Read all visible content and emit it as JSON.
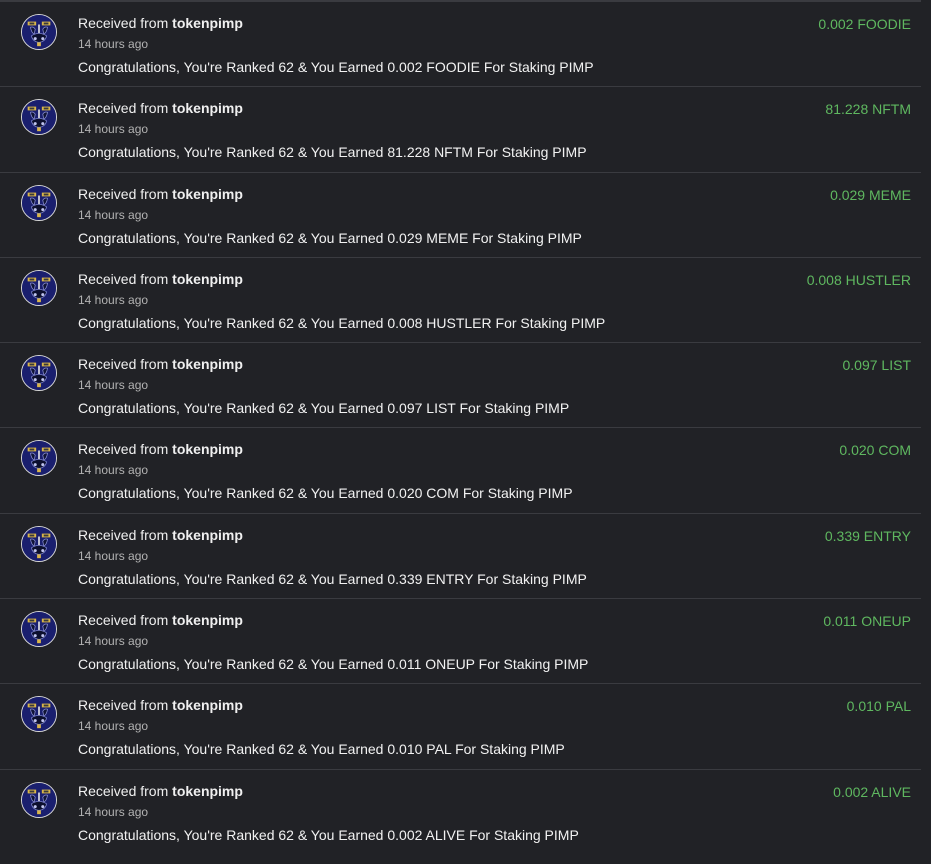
{
  "colors": {
    "background": "#212226",
    "divider": "#3a3b40",
    "amount": "#5fb860",
    "avatar_bg": "#1a1f6e"
  },
  "avatar_icon": "pimp-avatar-icon",
  "transactions": [
    {
      "prefix": "Received from",
      "sender": "tokenpimp",
      "time": "14 hours ago",
      "message": "Congratulations, You're Ranked 62 & You Earned 0.002 FOODIE For Staking PIMP",
      "amount": "0.002 FOODIE"
    },
    {
      "prefix": "Received from",
      "sender": "tokenpimp",
      "time": "14 hours ago",
      "message": "Congratulations, You're Ranked 62 & You Earned 81.228 NFTM For Staking PIMP",
      "amount": "81.228 NFTM"
    },
    {
      "prefix": "Received from",
      "sender": "tokenpimp",
      "time": "14 hours ago",
      "message": "Congratulations, You're Ranked 62 & You Earned 0.029 MEME For Staking PIMP",
      "amount": "0.029 MEME"
    },
    {
      "prefix": "Received from",
      "sender": "tokenpimp",
      "time": "14 hours ago",
      "message": "Congratulations, You're Ranked 62 & You Earned 0.008 HUSTLER For Staking PIMP",
      "amount": "0.008 HUSTLER"
    },
    {
      "prefix": "Received from",
      "sender": "tokenpimp",
      "time": "14 hours ago",
      "message": "Congratulations, You're Ranked 62 & You Earned 0.097 LIST For Staking PIMP",
      "amount": "0.097 LIST"
    },
    {
      "prefix": "Received from",
      "sender": "tokenpimp",
      "time": "14 hours ago",
      "message": "Congratulations, You're Ranked 62 & You Earned 0.020 COM For Staking PIMP",
      "amount": "0.020 COM"
    },
    {
      "prefix": "Received from",
      "sender": "tokenpimp",
      "time": "14 hours ago",
      "message": "Congratulations, You're Ranked 62 & You Earned 0.339 ENTRY For Staking PIMP",
      "amount": "0.339 ENTRY"
    },
    {
      "prefix": "Received from",
      "sender": "tokenpimp",
      "time": "14 hours ago",
      "message": "Congratulations, You're Ranked 62 & You Earned 0.011 ONEUP For Staking PIMP",
      "amount": "0.011 ONEUP"
    },
    {
      "prefix": "Received from",
      "sender": "tokenpimp",
      "time": "14 hours ago",
      "message": "Congratulations, You're Ranked 62 & You Earned 0.010 PAL For Staking PIMP",
      "amount": "0.010 PAL"
    },
    {
      "prefix": "Received from",
      "sender": "tokenpimp",
      "time": "14 hours ago",
      "message": "Congratulations, You're Ranked 62 & You Earned 0.002 ALIVE For Staking PIMP",
      "amount": "0.002 ALIVE"
    }
  ]
}
